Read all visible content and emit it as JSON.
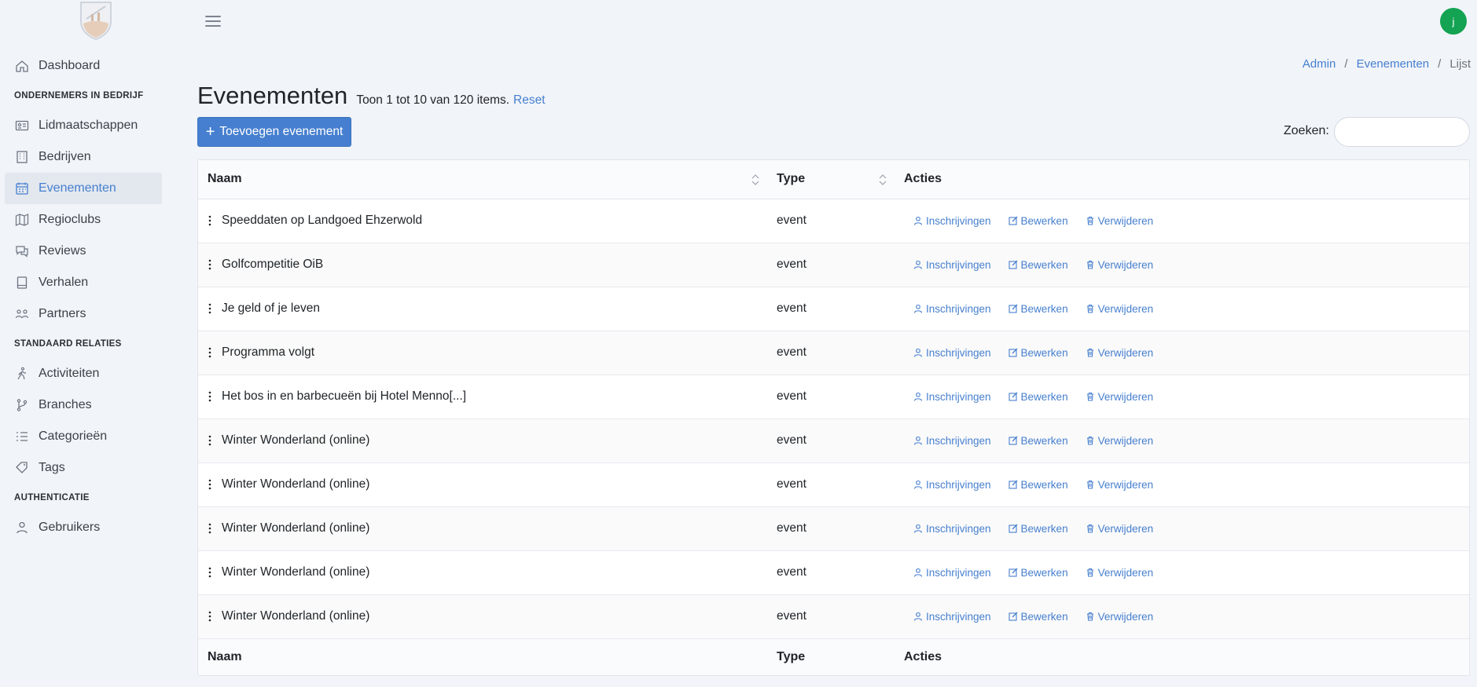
{
  "sidebar": {
    "items": [
      {
        "type": "item",
        "label": "Dashboard",
        "icon": "home-icon",
        "active": false
      },
      {
        "type": "section",
        "label": "ONDERNEMERS IN BEDRIJF"
      },
      {
        "type": "item",
        "label": "Lidmaatschappen",
        "icon": "id-card-icon",
        "active": false
      },
      {
        "type": "item",
        "label": "Bedrijven",
        "icon": "building-icon",
        "active": false
      },
      {
        "type": "item",
        "label": "Evenementen",
        "icon": "calendar-icon",
        "active": true
      },
      {
        "type": "item",
        "label": "Regioclubs",
        "icon": "map-icon",
        "active": false
      },
      {
        "type": "item",
        "label": "Reviews",
        "icon": "chat-icon",
        "active": false
      },
      {
        "type": "item",
        "label": "Verhalen",
        "icon": "book-icon",
        "active": false
      },
      {
        "type": "item",
        "label": "Partners",
        "icon": "people-icon",
        "active": false
      },
      {
        "type": "section",
        "label": "STANDAARD RELATIES"
      },
      {
        "type": "item",
        "label": "Activiteiten",
        "icon": "walking-icon",
        "active": false
      },
      {
        "type": "item",
        "label": "Branches",
        "icon": "branch-icon",
        "active": false
      },
      {
        "type": "item",
        "label": "Categorieën",
        "icon": "list-icon",
        "active": false
      },
      {
        "type": "item",
        "label": "Tags",
        "icon": "tag-icon",
        "active": false
      },
      {
        "type": "section",
        "label": "AUTHENTICATIE"
      },
      {
        "type": "item",
        "label": "Gebruikers",
        "icon": "user-icon",
        "active": false
      }
    ]
  },
  "header": {
    "avatar_initial": "j"
  },
  "breadcrumb": [
    "Admin",
    "Evenementen",
    "Lijst"
  ],
  "page": {
    "title": "Evenementen",
    "subtitle": "Toon 1 tot 10 van 120 items.",
    "reset_label": "Reset",
    "add_button_label": "Toevoegen evenement",
    "search_label": "Zoeken:",
    "search_value": ""
  },
  "table": {
    "columns": [
      "Naam",
      "Type",
      "Acties"
    ],
    "action_labels": [
      "Inschrijvingen",
      "Bewerken",
      "Verwijderen"
    ],
    "rows": [
      {
        "name": "Speeddaten op Landgoed Ehzerwold",
        "type": "event"
      },
      {
        "name": "Golfcompetitie OiB",
        "type": "event"
      },
      {
        "name": "Je geld of je leven",
        "type": "event"
      },
      {
        "name": "Programma volgt",
        "type": "event"
      },
      {
        "name": "Het bos in en barbecueën bij Hotel Menno[...]",
        "type": "event"
      },
      {
        "name": "Winter Wonderland (online)",
        "type": "event"
      },
      {
        "name": "Winter Wonderland (online)",
        "type": "event"
      },
      {
        "name": "Winter Wonderland (online)",
        "type": "event"
      },
      {
        "name": "Winter Wonderland (online)",
        "type": "event"
      },
      {
        "name": "Winter Wonderland (online)",
        "type": "event"
      }
    ]
  },
  "colors": {
    "accent": "#467fcf",
    "avatar": "#13a352",
    "background": "#f1f4f8"
  }
}
